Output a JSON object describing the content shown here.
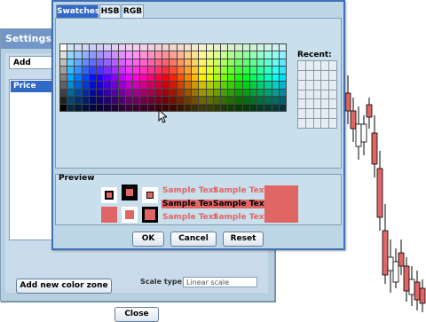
{
  "settings": {
    "title": "Settings - P",
    "add_select": "Add",
    "list_items": [
      "Price"
    ],
    "add_zone_button": "Add new color zone",
    "scale_type_label": "Scale type",
    "scale_type_value": "Linear scale",
    "close_button": "Close"
  },
  "color_chooser": {
    "tabs": [
      "Swatches",
      "HSB",
      "RGB"
    ],
    "active_tab": "Swatches",
    "recent_label": "Recent:",
    "preview_label": "Preview",
    "sample_text": "Sample Text",
    "ok_button": "OK",
    "cancel_button": "Cancel",
    "reset_button": "Reset",
    "selected_color": "#e06666"
  },
  "colors": {
    "accent": "#3169c6",
    "dialog_border": "#3f6fb4",
    "candle_red": "#e06666"
  }
}
